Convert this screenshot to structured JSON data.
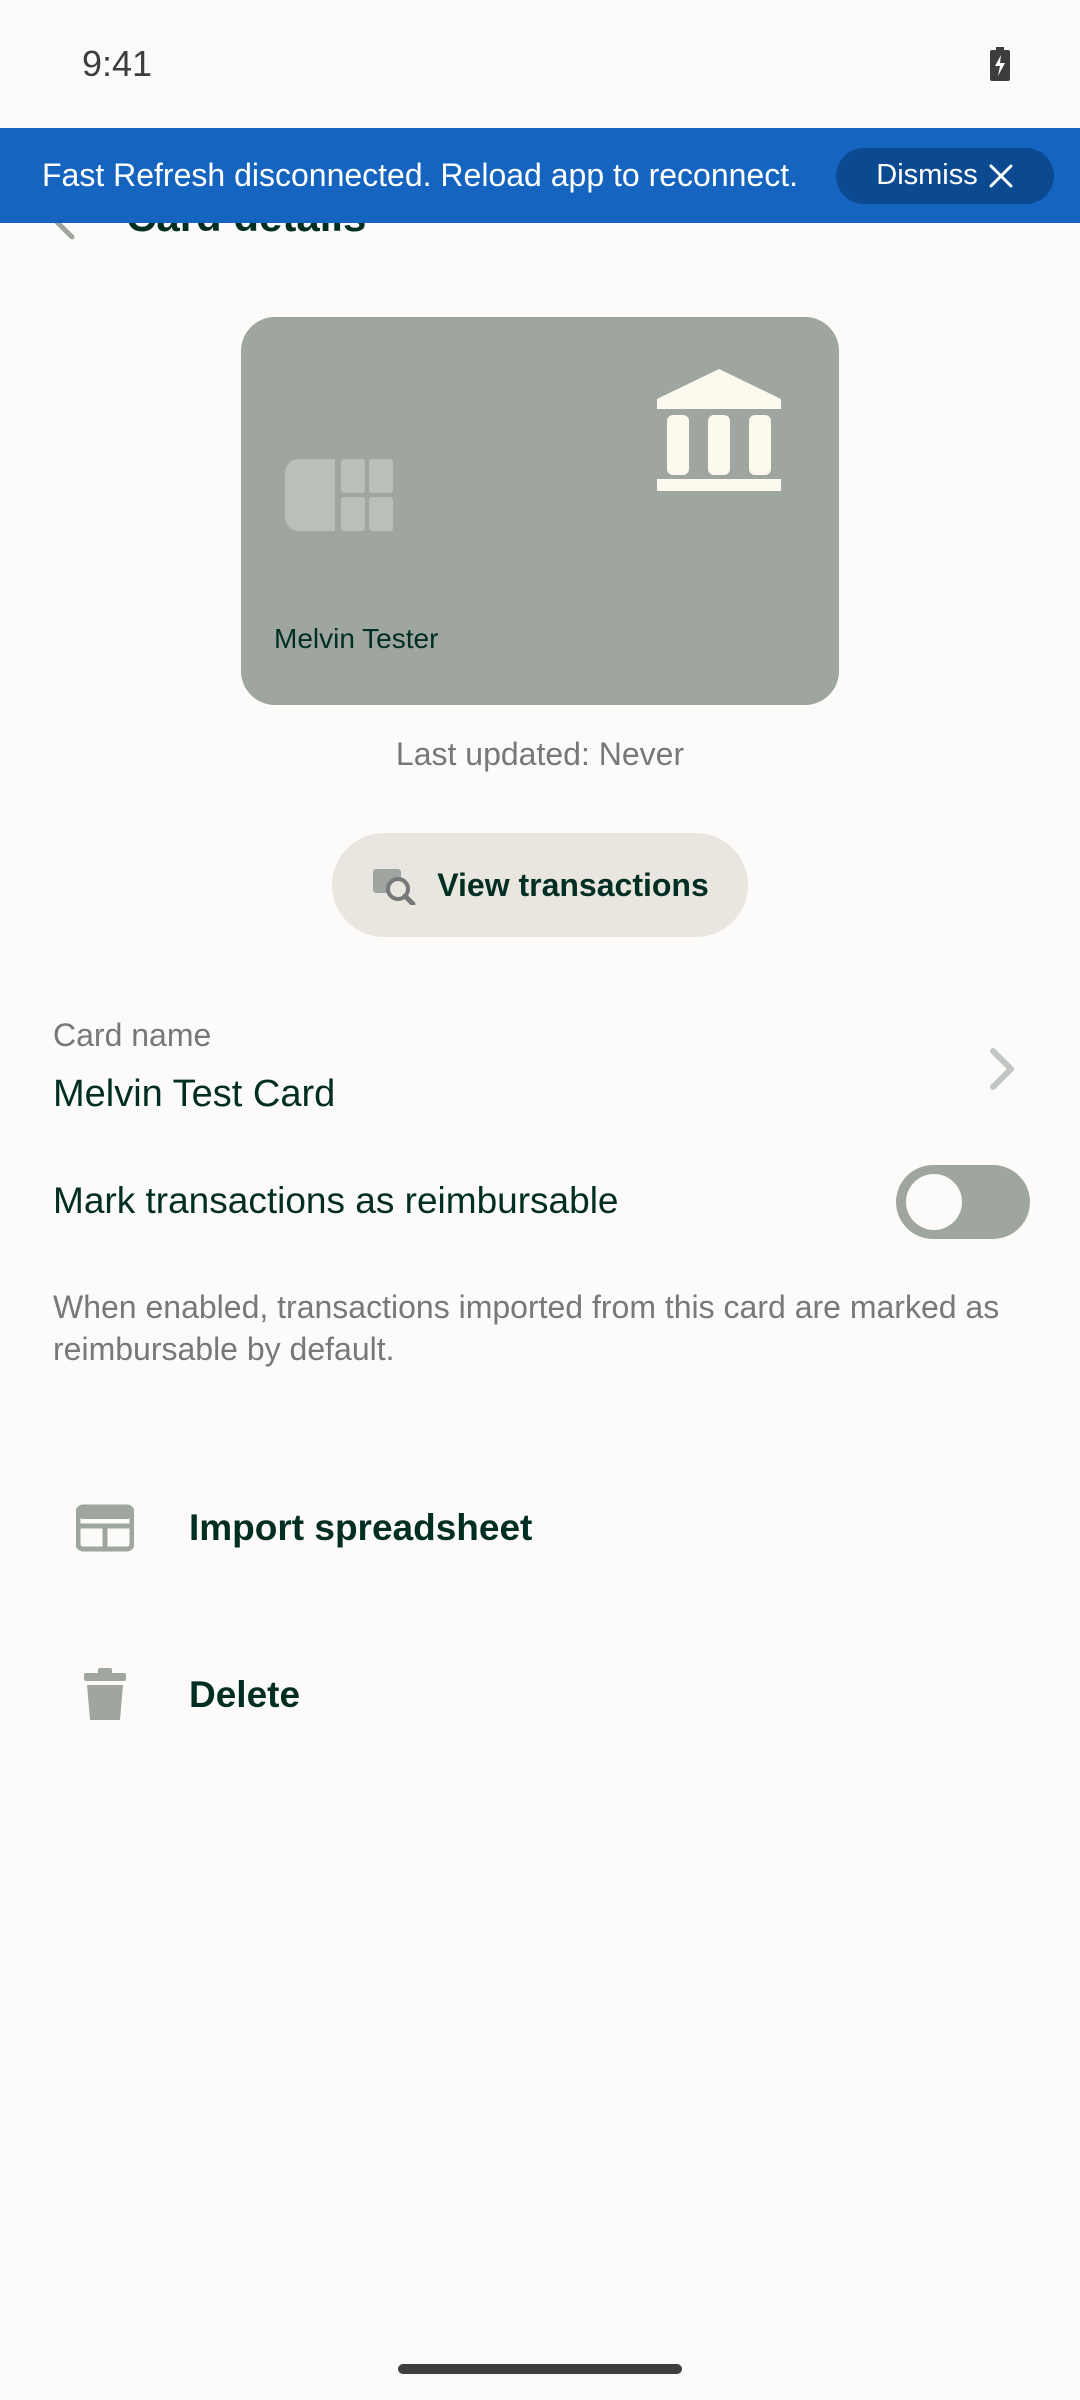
{
  "status_bar": {
    "time": "9:41"
  },
  "banner": {
    "message": "Fast Refresh disconnected. Reload app to reconnect.",
    "dismiss_label": "Dismiss"
  },
  "header": {
    "title": "Card details"
  },
  "card": {
    "holder_name": "Melvin Tester",
    "color": "#9FA69F"
  },
  "last_updated": "Last updated: Never",
  "view_transactions": {
    "label": "View transactions"
  },
  "card_name": {
    "label": "Card name",
    "value": "Melvin Test Card"
  },
  "reimbursable": {
    "label": "Mark transactions as reimbursable",
    "enabled": false,
    "help": "When enabled, transactions imported from this card are marked as reimbursable by default."
  },
  "menu": [
    {
      "label": "Import spreadsheet",
      "icon": "table-icon"
    },
    {
      "label": "Delete",
      "icon": "trash-icon"
    }
  ],
  "colors": {
    "text_primary": "#002E22",
    "text_secondary": "#76787A",
    "banner": "#1565C0",
    "background": "#FCFBF9"
  }
}
